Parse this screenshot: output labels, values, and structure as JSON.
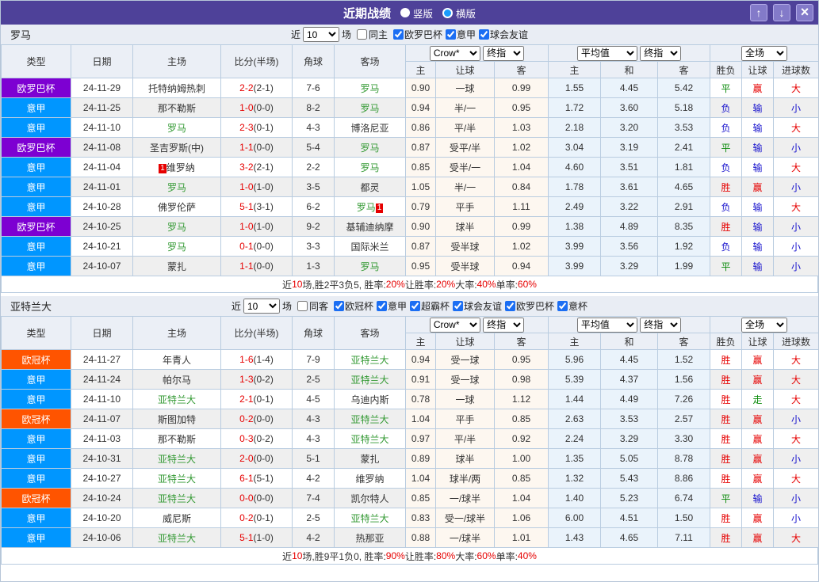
{
  "title_bar": {
    "title": "近期战绩",
    "vertical_label": "竖版",
    "horizontal_label": "横版",
    "up_icon": "↑",
    "down_icon": "↓",
    "close_icon": "×"
  },
  "labels": {
    "near": "近",
    "games": "场"
  },
  "columns": {
    "type": "类型",
    "date": "日期",
    "home": "主场",
    "score": "比分(半场)",
    "corner": "角球",
    "away": "客场",
    "crow": "Crow*",
    "final": "终指",
    "avg": "平均值",
    "final2": "终指",
    "full": "全场",
    "home_o": "主",
    "handicap": "让球",
    "away_o": "客",
    "avg_home": "主",
    "avg_draw": "和",
    "avg_away": "客",
    "wdl": "胜负",
    "handicap_r": "让球",
    "goals": "进球数"
  },
  "colors": {
    "titlebar": "#4e4199",
    "europa_badge": "#7d00d2",
    "serie_a_badge": "#0096ff",
    "ucl_badge": "#ff5400",
    "team_green": "#339933",
    "win_red": "#e60000",
    "lose_blue": "#1712cd",
    "draw_green": "#0a8a0a"
  },
  "sections": [
    {
      "team": "罗马",
      "filter": {
        "games": "10",
        "same_label": "同主",
        "leagues": [
          {
            "label": "欧罗巴杯"
          },
          {
            "label": "意甲"
          },
          {
            "label": "球会友谊"
          }
        ]
      },
      "rows": [
        {
          "type": "欧罗巴杯",
          "tcls": "t-purple",
          "date": "24-11-29",
          "home": "托特纳姆热刺",
          "score": "2-2",
          "half": "(2-1)",
          "corner": "7-6",
          "away": "罗马",
          "acls": "green",
          "o1": "0.90",
          "o2": "一球",
          "o3": "0.99",
          "a1": "1.55",
          "a2": "4.45",
          "a3": "5.42",
          "r1": "平",
          "c1": "g",
          "r2": "赢",
          "c2": "r",
          "r3": "大",
          "c3": "r"
        },
        {
          "type": "意甲",
          "tcls": "t-blue",
          "date": "24-11-25",
          "home": "那不勒斯",
          "score": "1-0",
          "half": "(0-0)",
          "corner": "8-2",
          "away": "罗马",
          "acls": "green",
          "o1": "0.94",
          "o2": "半/一",
          "o3": "0.95",
          "a1": "1.72",
          "a2": "3.60",
          "a3": "5.18",
          "r1": "负",
          "c1": "b",
          "r2": "输",
          "c2": "b",
          "r3": "小",
          "c3": "b"
        },
        {
          "type": "意甲",
          "tcls": "t-blue",
          "date": "24-11-10",
          "home": "罗马",
          "hcls": "green",
          "score": "2-3",
          "half": "(0-1)",
          "corner": "4-3",
          "away": "博洛尼亚",
          "o1": "0.86",
          "o2": "平/半",
          "o3": "1.03",
          "a1": "2.18",
          "a2": "3.20",
          "a3": "3.53",
          "r1": "负",
          "c1": "b",
          "r2": "输",
          "c2": "b",
          "r3": "大",
          "c3": "r"
        },
        {
          "type": "欧罗巴杯",
          "tcls": "t-purple",
          "date": "24-11-08",
          "home": "圣吉罗斯(中)",
          "score": "1-1",
          "half": "(0-0)",
          "corner": "5-4",
          "away": "罗马",
          "acls": "green",
          "o1": "0.87",
          "o2": "受平/半",
          "o3": "1.02",
          "a1": "3.04",
          "a2": "3.19",
          "a3": "2.41",
          "r1": "平",
          "c1": "g",
          "r2": "输",
          "c2": "b",
          "r3": "小",
          "c3": "b"
        },
        {
          "type": "意甲",
          "tcls": "t-blue",
          "date": "24-11-04",
          "home": "维罗纳",
          "hrb": "1",
          "score": "3-2",
          "half": "(2-1)",
          "corner": "2-2",
          "away": "罗马",
          "acls": "green",
          "o1": "0.85",
          "o2": "受半/一",
          "o3": "1.04",
          "a1": "4.60",
          "a2": "3.51",
          "a3": "1.81",
          "r1": "负",
          "c1": "b",
          "r2": "输",
          "c2": "b",
          "r3": "大",
          "c3": "r"
        },
        {
          "type": "意甲",
          "tcls": "t-blue",
          "date": "24-11-01",
          "home": "罗马",
          "hcls": "green",
          "score": "1-0",
          "half": "(1-0)",
          "corner": "3-5",
          "away": "都灵",
          "o1": "1.05",
          "o2": "半/一",
          "o3": "0.84",
          "a1": "1.78",
          "a2": "3.61",
          "a3": "4.65",
          "r1": "胜",
          "c1": "r",
          "r2": "赢",
          "c2": "r",
          "r3": "小",
          "c3": "b"
        },
        {
          "type": "意甲",
          "tcls": "t-blue",
          "date": "24-10-28",
          "home": "佛罗伦萨",
          "score": "5-1",
          "half": "(3-1)",
          "corner": "6-2",
          "away": "罗马",
          "acls": "green",
          "ara": "1",
          "o1": "0.79",
          "o2": "平手",
          "o3": "1.11",
          "a1": "2.49",
          "a2": "3.22",
          "a3": "2.91",
          "r1": "负",
          "c1": "b",
          "r2": "输",
          "c2": "b",
          "r3": "大",
          "c3": "r"
        },
        {
          "type": "欧罗巴杯",
          "tcls": "t-purple",
          "date": "24-10-25",
          "home": "罗马",
          "hcls": "green",
          "score": "1-0",
          "half": "(1-0)",
          "corner": "9-2",
          "away": "基辅迪纳摩",
          "o1": "0.90",
          "o2": "球半",
          "o3": "0.99",
          "a1": "1.38",
          "a2": "4.89",
          "a3": "8.35",
          "r1": "胜",
          "c1": "r",
          "r2": "输",
          "c2": "b",
          "r3": "小",
          "c3": "b"
        },
        {
          "type": "意甲",
          "tcls": "t-blue",
          "date": "24-10-21",
          "home": "罗马",
          "hcls": "green",
          "score": "0-1",
          "half": "(0-0)",
          "corner": "3-3",
          "away": "国际米兰",
          "o1": "0.87",
          "o2": "受半球",
          "o3": "1.02",
          "a1": "3.99",
          "a2": "3.56",
          "a3": "1.92",
          "r1": "负",
          "c1": "b",
          "r2": "输",
          "c2": "b",
          "r3": "小",
          "c3": "b"
        },
        {
          "type": "意甲",
          "tcls": "t-blue",
          "date": "24-10-07",
          "home": "蒙扎",
          "score": "1-1",
          "half": "(0-0)",
          "corner": "1-3",
          "away": "罗马",
          "acls": "green",
          "o1": "0.95",
          "o2": "受半球",
          "o3": "0.94",
          "a1": "3.99",
          "a2": "3.29",
          "a3": "1.99",
          "r1": "平",
          "c1": "g",
          "r2": "输",
          "c2": "b",
          "r3": "小",
          "c3": "b"
        }
      ],
      "summary": [
        {
          "t": "近"
        },
        {
          "t": "10",
          "c": "red"
        },
        {
          "t": "场,胜2平3负5, 胜率:"
        },
        {
          "t": "20%",
          "c": "red"
        },
        {
          "t": " 让胜率:"
        },
        {
          "t": "20%",
          "c": "red"
        },
        {
          "t": " 大率:"
        },
        {
          "t": "40%",
          "c": "red"
        },
        {
          "t": " 单率:"
        },
        {
          "t": "60%",
          "c": "red"
        }
      ]
    },
    {
      "team": "亚特兰大",
      "filter": {
        "games": "10",
        "same_label": "同客",
        "leagues": [
          {
            "label": "欧冠杯"
          },
          {
            "label": "意甲"
          },
          {
            "label": "超霸杯"
          },
          {
            "label": "球会友谊"
          },
          {
            "label": "欧罗巴杯"
          },
          {
            "label": "意杯"
          }
        ]
      },
      "rows": [
        {
          "type": "欧冠杯",
          "tcls": "t-orange",
          "date": "24-11-27",
          "home": "年青人",
          "score": "1-6",
          "half": "(1-4)",
          "corner": "7-9",
          "away": "亚特兰大",
          "acls": "green",
          "o1": "0.94",
          "o2": "受一球",
          "o3": "0.95",
          "a1": "5.96",
          "a2": "4.45",
          "a3": "1.52",
          "r1": "胜",
          "c1": "r",
          "r2": "赢",
          "c2": "r",
          "r3": "大",
          "c3": "r"
        },
        {
          "type": "意甲",
          "tcls": "t-blue",
          "date": "24-11-24",
          "home": "帕尔马",
          "score": "1-3",
          "half": "(0-2)",
          "corner": "2-5",
          "away": "亚特兰大",
          "acls": "green",
          "o1": "0.91",
          "o2": "受一球",
          "o3": "0.98",
          "a1": "5.39",
          "a2": "4.37",
          "a3": "1.56",
          "r1": "胜",
          "c1": "r",
          "r2": "赢",
          "c2": "r",
          "r3": "大",
          "c3": "r"
        },
        {
          "type": "意甲",
          "tcls": "t-blue",
          "date": "24-11-10",
          "home": "亚特兰大",
          "hcls": "green",
          "score": "2-1",
          "half": "(0-1)",
          "corner": "4-5",
          "away": "乌迪内斯",
          "o1": "0.78",
          "o2": "一球",
          "o3": "1.12",
          "a1": "1.44",
          "a2": "4.49",
          "a3": "7.26",
          "r1": "胜",
          "c1": "r",
          "r2": "走",
          "c2": "g",
          "r3": "大",
          "c3": "r"
        },
        {
          "type": "欧冠杯",
          "tcls": "t-orange",
          "date": "24-11-07",
          "home": "斯图加特",
          "score": "0-2",
          "half": "(0-0)",
          "corner": "4-3",
          "away": "亚特兰大",
          "acls": "green",
          "o1": "1.04",
          "o2": "平手",
          "o3": "0.85",
          "a1": "2.63",
          "a2": "3.53",
          "a3": "2.57",
          "r1": "胜",
          "c1": "r",
          "r2": "赢",
          "c2": "r",
          "r3": "小",
          "c3": "b"
        },
        {
          "type": "意甲",
          "tcls": "t-blue",
          "date": "24-11-03",
          "home": "那不勒斯",
          "score": "0-3",
          "half": "(0-2)",
          "corner": "4-3",
          "away": "亚特兰大",
          "acls": "green",
          "o1": "0.97",
          "o2": "平/半",
          "o3": "0.92",
          "a1": "2.24",
          "a2": "3.29",
          "a3": "3.30",
          "r1": "胜",
          "c1": "r",
          "r2": "赢",
          "c2": "r",
          "r3": "大",
          "c3": "r"
        },
        {
          "type": "意甲",
          "tcls": "t-blue",
          "date": "24-10-31",
          "home": "亚特兰大",
          "hcls": "green",
          "score": "2-0",
          "half": "(0-0)",
          "corner": "5-1",
          "away": "蒙扎",
          "o1": "0.89",
          "o2": "球半",
          "o3": "1.00",
          "a1": "1.35",
          "a2": "5.05",
          "a3": "8.78",
          "r1": "胜",
          "c1": "r",
          "r2": "赢",
          "c2": "r",
          "r3": "小",
          "c3": "b"
        },
        {
          "type": "意甲",
          "tcls": "t-blue",
          "date": "24-10-27",
          "home": "亚特兰大",
          "hcls": "green",
          "score": "6-1",
          "half": "(5-1)",
          "corner": "4-2",
          "away": "维罗纳",
          "o1": "1.04",
          "o2": "球半/两",
          "o3": "0.85",
          "a1": "1.32",
          "a2": "5.43",
          "a3": "8.86",
          "r1": "胜",
          "c1": "r",
          "r2": "赢",
          "c2": "r",
          "r3": "大",
          "c3": "r"
        },
        {
          "type": "欧冠杯",
          "tcls": "t-orange",
          "date": "24-10-24",
          "home": "亚特兰大",
          "hcls": "green",
          "score": "0-0",
          "half": "(0-0)",
          "corner": "7-4",
          "away": "凯尔特人",
          "o1": "0.85",
          "o2": "一/球半",
          "o3": "1.04",
          "a1": "1.40",
          "a2": "5.23",
          "a3": "6.74",
          "r1": "平",
          "c1": "g",
          "r2": "输",
          "c2": "b",
          "r3": "小",
          "c3": "b"
        },
        {
          "type": "意甲",
          "tcls": "t-blue",
          "date": "24-10-20",
          "home": "威尼斯",
          "score": "0-2",
          "half": "(0-1)",
          "corner": "2-5",
          "away": "亚特兰大",
          "acls": "green",
          "o1": "0.83",
          "o2": "受一/球半",
          "o3": "1.06",
          "a1": "6.00",
          "a2": "4.51",
          "a3": "1.50",
          "r1": "胜",
          "c1": "r",
          "r2": "赢",
          "c2": "r",
          "r3": "小",
          "c3": "b"
        },
        {
          "type": "意甲",
          "tcls": "t-blue",
          "date": "24-10-06",
          "home": "亚特兰大",
          "hcls": "green",
          "score": "5-1",
          "half": "(1-0)",
          "corner": "4-2",
          "away": "热那亚",
          "o1": "0.88",
          "o2": "一/球半",
          "o3": "1.01",
          "a1": "1.43",
          "a2": "4.65",
          "a3": "7.11",
          "r1": "胜",
          "c1": "r",
          "r2": "赢",
          "c2": "r",
          "r3": "大",
          "c3": "r"
        }
      ],
      "summary": [
        {
          "t": "近"
        },
        {
          "t": "10",
          "c": "red"
        },
        {
          "t": "场,胜9平1负0, 胜率:"
        },
        {
          "t": "90%",
          "c": "red"
        },
        {
          "t": " 让胜率:"
        },
        {
          "t": "80%",
          "c": "red"
        },
        {
          "t": " 大率:"
        },
        {
          "t": "60%",
          "c": "red"
        },
        {
          "t": " 单率:"
        },
        {
          "t": "40%",
          "c": "red"
        }
      ]
    }
  ]
}
